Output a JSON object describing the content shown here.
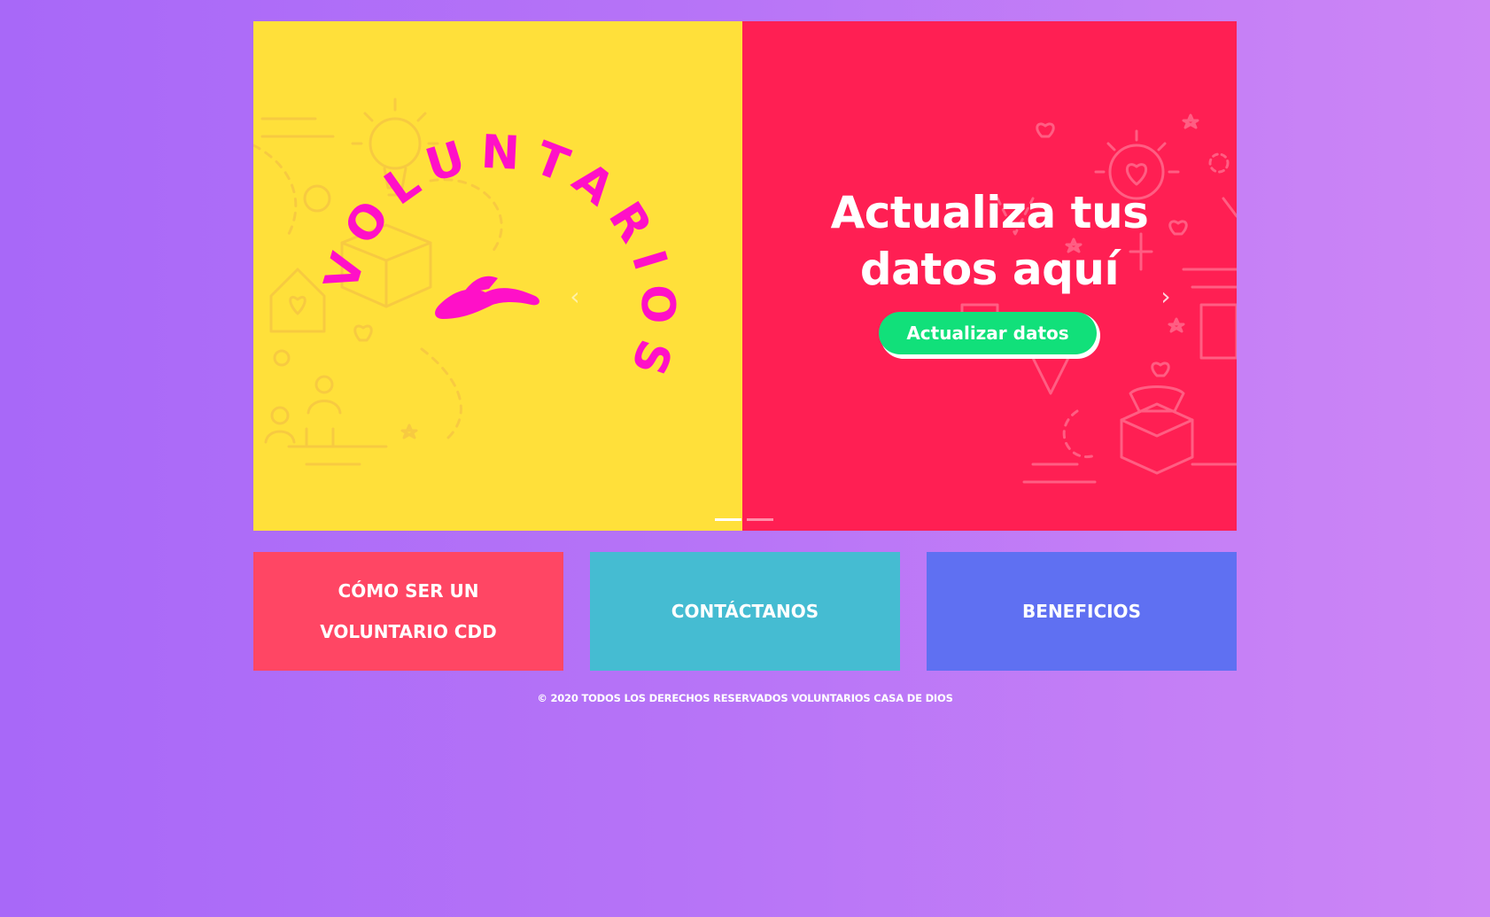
{
  "carousel": {
    "slide_logo_text": "VOLUNTARIOS",
    "headline_line1": "Actualiza tus",
    "headline_line2": "datos aquí",
    "cta_label": "Actualizar datos",
    "prev_label": "‹",
    "next_label": "›",
    "active_slide": 1,
    "slide_count": 2,
    "colors": {
      "left_panel": "#ffe03a",
      "right_panel": "#ff1f53",
      "logo": "#ff10c8",
      "cta": "#11e07a"
    }
  },
  "tiles": [
    {
      "label_line1": "CÓMO SER UN",
      "label_line2": "VOLUNTARIO CDD",
      "color": "#ff4664"
    },
    {
      "label_line1": "CONTÁCTANOS",
      "label_line2": "",
      "color": "#45bcd2"
    },
    {
      "label_line1": "BENEFICIOS",
      "label_line2": "",
      "color": "#5f70f2"
    }
  ],
  "footer": {
    "text": "© 2020 TODOS LOS DERECHOS RESERVADOS VOLUNTARIOS CASA DE DIOS"
  }
}
